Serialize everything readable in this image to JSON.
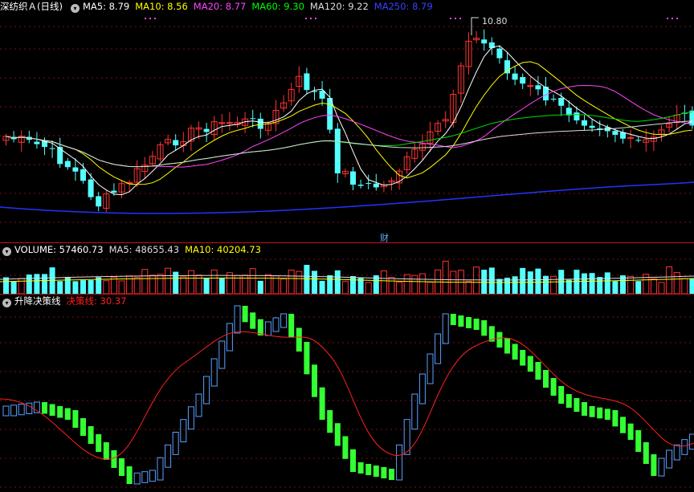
{
  "main_panel": {
    "title": "深纺织Ａ(日线)",
    "indicators": [
      {
        "label": "MA5: 8.79",
        "color": "#ffffff"
      },
      {
        "label": "MA10: 8.56",
        "color": "#ffff00"
      },
      {
        "label": "MA20: 8.77",
        "color": "#ff44ff"
      },
      {
        "label": "MA60: 9.30",
        "color": "#00ff00"
      },
      {
        "label": "MA120: 9.22",
        "color": "#dddddd"
      },
      {
        "label": "MA250: 8.79",
        "color": "#3344ff"
      }
    ],
    "high_label": "10.80",
    "event_label": "财"
  },
  "volume_panel": {
    "indicators": [
      {
        "label": "VOLUME: 57460.73",
        "color": "#ffffff"
      },
      {
        "label": "MA5: 48655.43",
        "color": "#dddddd"
      },
      {
        "label": "MA10: 40204.73",
        "color": "#ffff00"
      }
    ]
  },
  "signal_panel": {
    "name": "升降决策线",
    "line_label": "决策线: 30.37",
    "line_color": "#ff2020"
  },
  "colors": {
    "up": "#ff3232",
    "down": "#54ffff",
    "rise_bar": "#5aa0ff",
    "fall_bar": "#33ff33"
  }
}
